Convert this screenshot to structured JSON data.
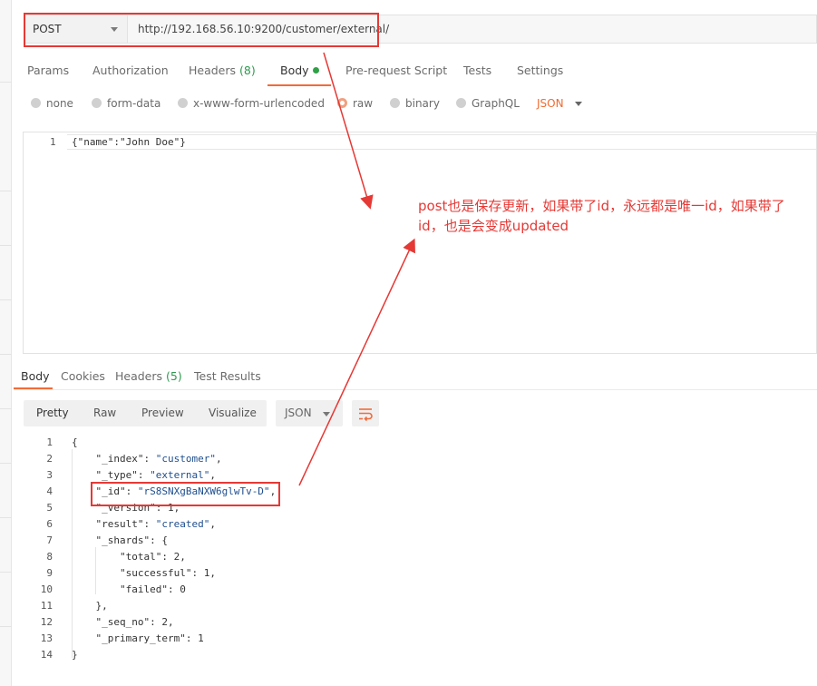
{
  "request": {
    "method": "POST",
    "url": "http://192.168.56.10:9200/customer/external/"
  },
  "request_tabs": [
    {
      "label": "Params"
    },
    {
      "label": "Authorization"
    },
    {
      "label": "Headers",
      "count": "(8)"
    },
    {
      "label": "Body"
    },
    {
      "label": "Pre-request Script"
    },
    {
      "label": "Tests"
    },
    {
      "label": "Settings"
    }
  ],
  "body_types": [
    {
      "label": "none"
    },
    {
      "label": "form-data"
    },
    {
      "label": "x-www-form-urlencoded"
    },
    {
      "label": "raw",
      "selected": true
    },
    {
      "label": "binary"
    },
    {
      "label": "GraphQL"
    }
  ],
  "body_format": "JSON",
  "request_body": {
    "line_number": "1",
    "code": "{\"name\":\"John Doe\"}"
  },
  "response_tabs": [
    {
      "label": "Body"
    },
    {
      "label": "Cookies"
    },
    {
      "label": "Headers",
      "count": "(5)"
    },
    {
      "label": "Test Results"
    }
  ],
  "response_toolbar": {
    "views": [
      "Pretty",
      "Raw",
      "Preview",
      "Visualize"
    ],
    "format": "JSON",
    "wrap_icon": "wrap-lines-icon"
  },
  "response_lines": [
    {
      "n": "1",
      "text": "{"
    },
    {
      "n": "2",
      "text": "    \"_index\": \"customer\","
    },
    {
      "n": "3",
      "text": "    \"_type\": \"external\","
    },
    {
      "n": "4",
      "text": "    \"_id\": \"rS8SNXgBaNXW6glwTv-D\","
    },
    {
      "n": "5",
      "text": "    \"_version\": 1,"
    },
    {
      "n": "6",
      "text": "    \"result\": \"created\","
    },
    {
      "n": "7",
      "text": "    \"_shards\": {"
    },
    {
      "n": "8",
      "text": "        \"total\": 2,"
    },
    {
      "n": "9",
      "text": "        \"successful\": 1,"
    },
    {
      "n": "10",
      "text": "        \"failed\": 0"
    },
    {
      "n": "11",
      "text": "    },"
    },
    {
      "n": "12",
      "text": "    \"_seq_no\": 2,"
    },
    {
      "n": "13",
      "text": "    \"_primary_term\": 1"
    },
    {
      "n": "14",
      "text": "}"
    }
  ],
  "annotation": {
    "text": "post也是保存更新，如果带了id，永远都是唯一id，如果带了id，也是会变成updated",
    "color": "#e53935"
  },
  "colors": {
    "accent": "#f26b3a",
    "count_green": "#2e9a4f",
    "annotation_red": "#e53935"
  }
}
